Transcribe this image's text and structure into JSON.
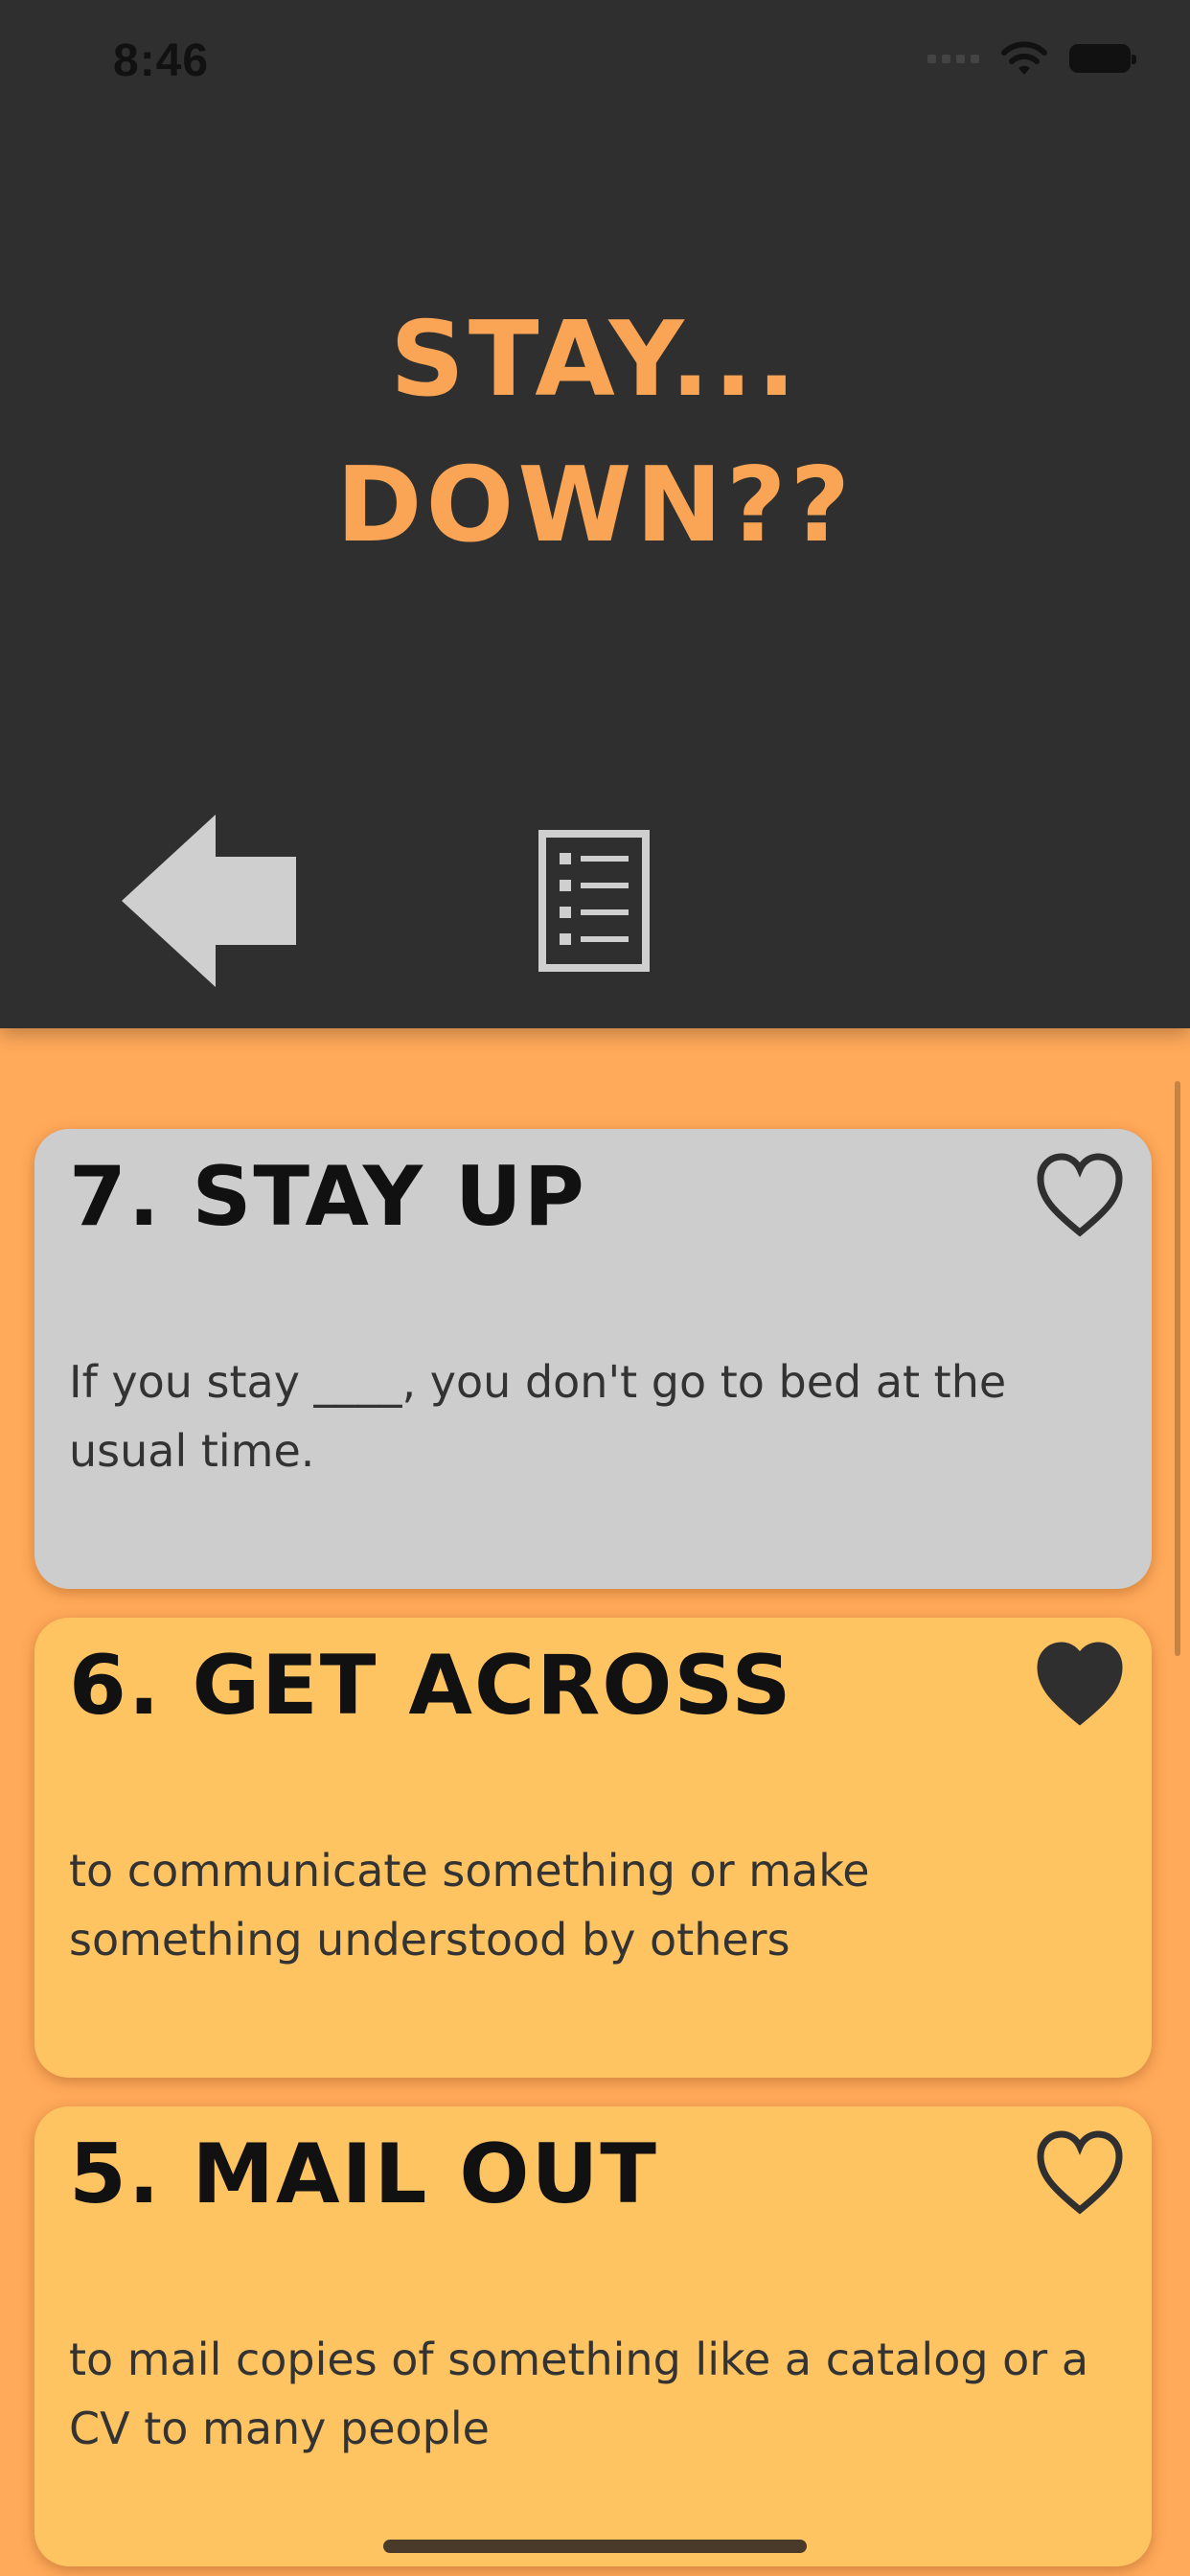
{
  "status_bar": {
    "time": "8:46"
  },
  "header": {
    "title_line1": "STAY...",
    "title_line2": "DOWN??"
  },
  "nav": {
    "back_icon": "arrow-left-icon",
    "list_icon": "list-icon"
  },
  "cards": [
    {
      "number": "7.",
      "phrase": "STAY UP",
      "definition": "If you stay ____, you don't go to bed at the usual time.",
      "favorite": false,
      "color": "#CDCDCD"
    },
    {
      "number": "6.",
      "phrase": "GET ACROSS",
      "definition": "to communicate something or make something understood by others",
      "favorite": true,
      "color": "#FFC462"
    },
    {
      "number": "5.",
      "phrase": "MAIL OUT",
      "definition": "to mail copies of something like a catalog or a CV to many people",
      "favorite": false,
      "color": "#FFC462"
    }
  ],
  "colors": {
    "header_bg": "#2F2F2F",
    "accent": "#F9A555",
    "page_bg": "#FFA95A"
  }
}
